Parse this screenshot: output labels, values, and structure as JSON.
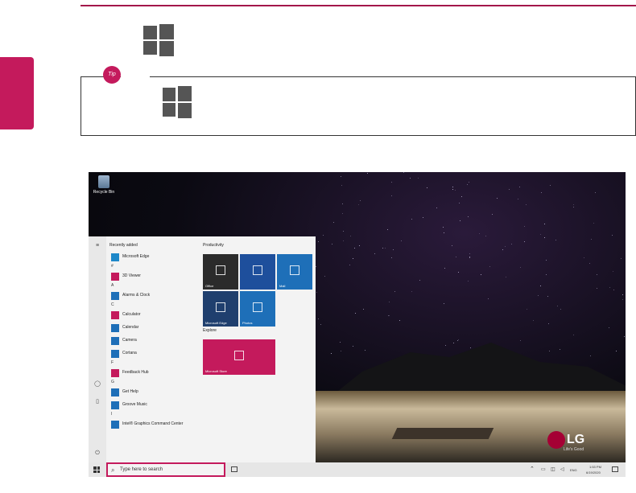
{
  "doc": {
    "tip_badge": "Tip",
    "accent_color": "#c41a5c"
  },
  "screenshot": {
    "desktop_icons": [
      {
        "label": "Recycle Bin",
        "icon": "recycle-bin-icon"
      }
    ],
    "start_menu": {
      "recently_added_header": "Recently added",
      "apps": [
        {
          "type": "app",
          "label": "Microsoft Edge",
          "icon": "edge-icon",
          "color": "#1e88c9"
        },
        {
          "type": "letter",
          "label": "#"
        },
        {
          "type": "app",
          "label": "3D Viewer",
          "icon": "3d-viewer-icon",
          "color": "#c41a5c"
        },
        {
          "type": "letter",
          "label": "A"
        },
        {
          "type": "app",
          "label": "Alarms & Clock",
          "icon": "alarm-icon",
          "color": "#1e6fb8"
        },
        {
          "type": "letter",
          "label": "C"
        },
        {
          "type": "app",
          "label": "Calculator",
          "icon": "calculator-icon",
          "color": "#c41a5c"
        },
        {
          "type": "app",
          "label": "Calendar",
          "icon": "calendar-icon",
          "color": "#1e6fb8"
        },
        {
          "type": "app",
          "label": "Camera",
          "icon": "camera-icon",
          "color": "#1e6fb8"
        },
        {
          "type": "app",
          "label": "Cortana",
          "icon": "cortana-icon",
          "color": "#1e6fb8"
        },
        {
          "type": "letter",
          "label": "F"
        },
        {
          "type": "app",
          "label": "Feedback Hub",
          "icon": "feedback-icon",
          "color": "#c41a5c"
        },
        {
          "type": "letter",
          "label": "G"
        },
        {
          "type": "app",
          "label": "Get Help",
          "icon": "help-icon",
          "color": "#1e6fb8"
        },
        {
          "type": "app",
          "label": "Groove Music",
          "icon": "music-icon",
          "color": "#1e6fb8"
        },
        {
          "type": "letter",
          "label": "I"
        },
        {
          "type": "app",
          "label": "Intel® Graphics Command Center",
          "icon": "intel-icon",
          "color": "#1e6fb8"
        }
      ],
      "productivity_header": "Productivity",
      "explore_header": "Explore",
      "tiles": [
        {
          "label": "Office",
          "color": "#2b2b2b",
          "icon": "office-icon"
        },
        {
          "label": "",
          "color": "#1e4f9c",
          "icon": "apps-group-icon"
        },
        {
          "label": "Mail",
          "color": "#1e6fb8",
          "icon": "mail-icon"
        },
        {
          "label": "Microsoft Edge",
          "color": "#1f3f6e",
          "icon": "edge-icon"
        },
        {
          "label": "Photos",
          "color": "#1e6fb8",
          "icon": "photos-icon"
        },
        {
          "label": "Microsoft Store",
          "color": "#c41a5c",
          "icon": "store-icon"
        }
      ]
    },
    "taskbar": {
      "search_placeholder": "Type here to search",
      "language": "ENG",
      "time": "1:53 PM",
      "date": "6/19/2020"
    },
    "wallpaper_brand": "LG",
    "wallpaper_tagline": "Life's Good"
  }
}
